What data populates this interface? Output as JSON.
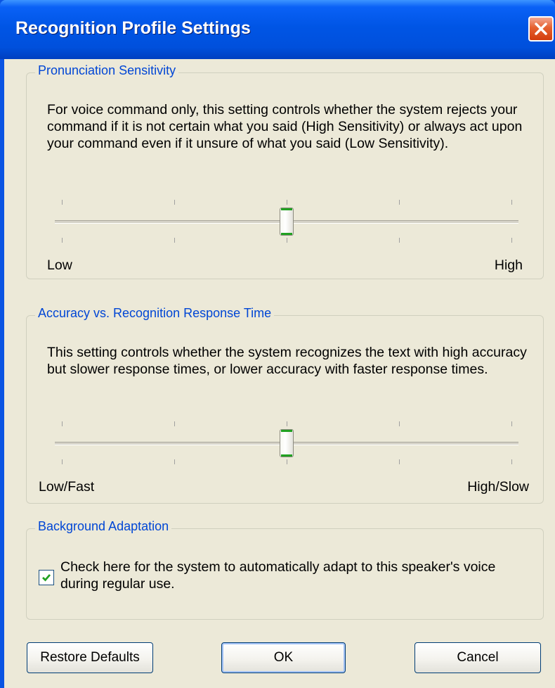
{
  "window": {
    "title": "Recognition Profile Settings"
  },
  "pronunciation": {
    "legend": "Pronunciation Sensitivity",
    "description": "For voice command only, this setting controls whether the system rejects your command if it is not certain what you said (High Sensitivity) or always act upon your command even if it unsure of what you said (Low Sensitivity).",
    "slider": {
      "min_label": "Low",
      "max_label": "High",
      "value_fraction": 0.5,
      "tick_count": 5
    }
  },
  "accuracy": {
    "legend": "Accuracy vs. Recognition Response Time",
    "description": "This setting controls whether the system recognizes the text with high accuracy but slower response times, or lower accuracy with faster response times.",
    "slider": {
      "min_label": "Low/Fast",
      "max_label": "High/Slow",
      "value_fraction": 0.5,
      "tick_count": 5
    }
  },
  "background": {
    "legend": "Background Adaptation",
    "checkbox_label": "Check here for the system to automatically adapt to this speaker's voice during regular use.",
    "checked": true
  },
  "buttons": {
    "restore": "Restore Defaults",
    "ok": "OK",
    "cancel": "Cancel"
  },
  "icons": {
    "close": "close-icon",
    "check": "checkmark-icon"
  },
  "colors": {
    "title_bar": "#0055e5",
    "client": "#ece9d8",
    "legend_text": "#0046d5",
    "thumb_accent": "#21a121",
    "check": "#21a121",
    "close_button": "#e5602f"
  }
}
